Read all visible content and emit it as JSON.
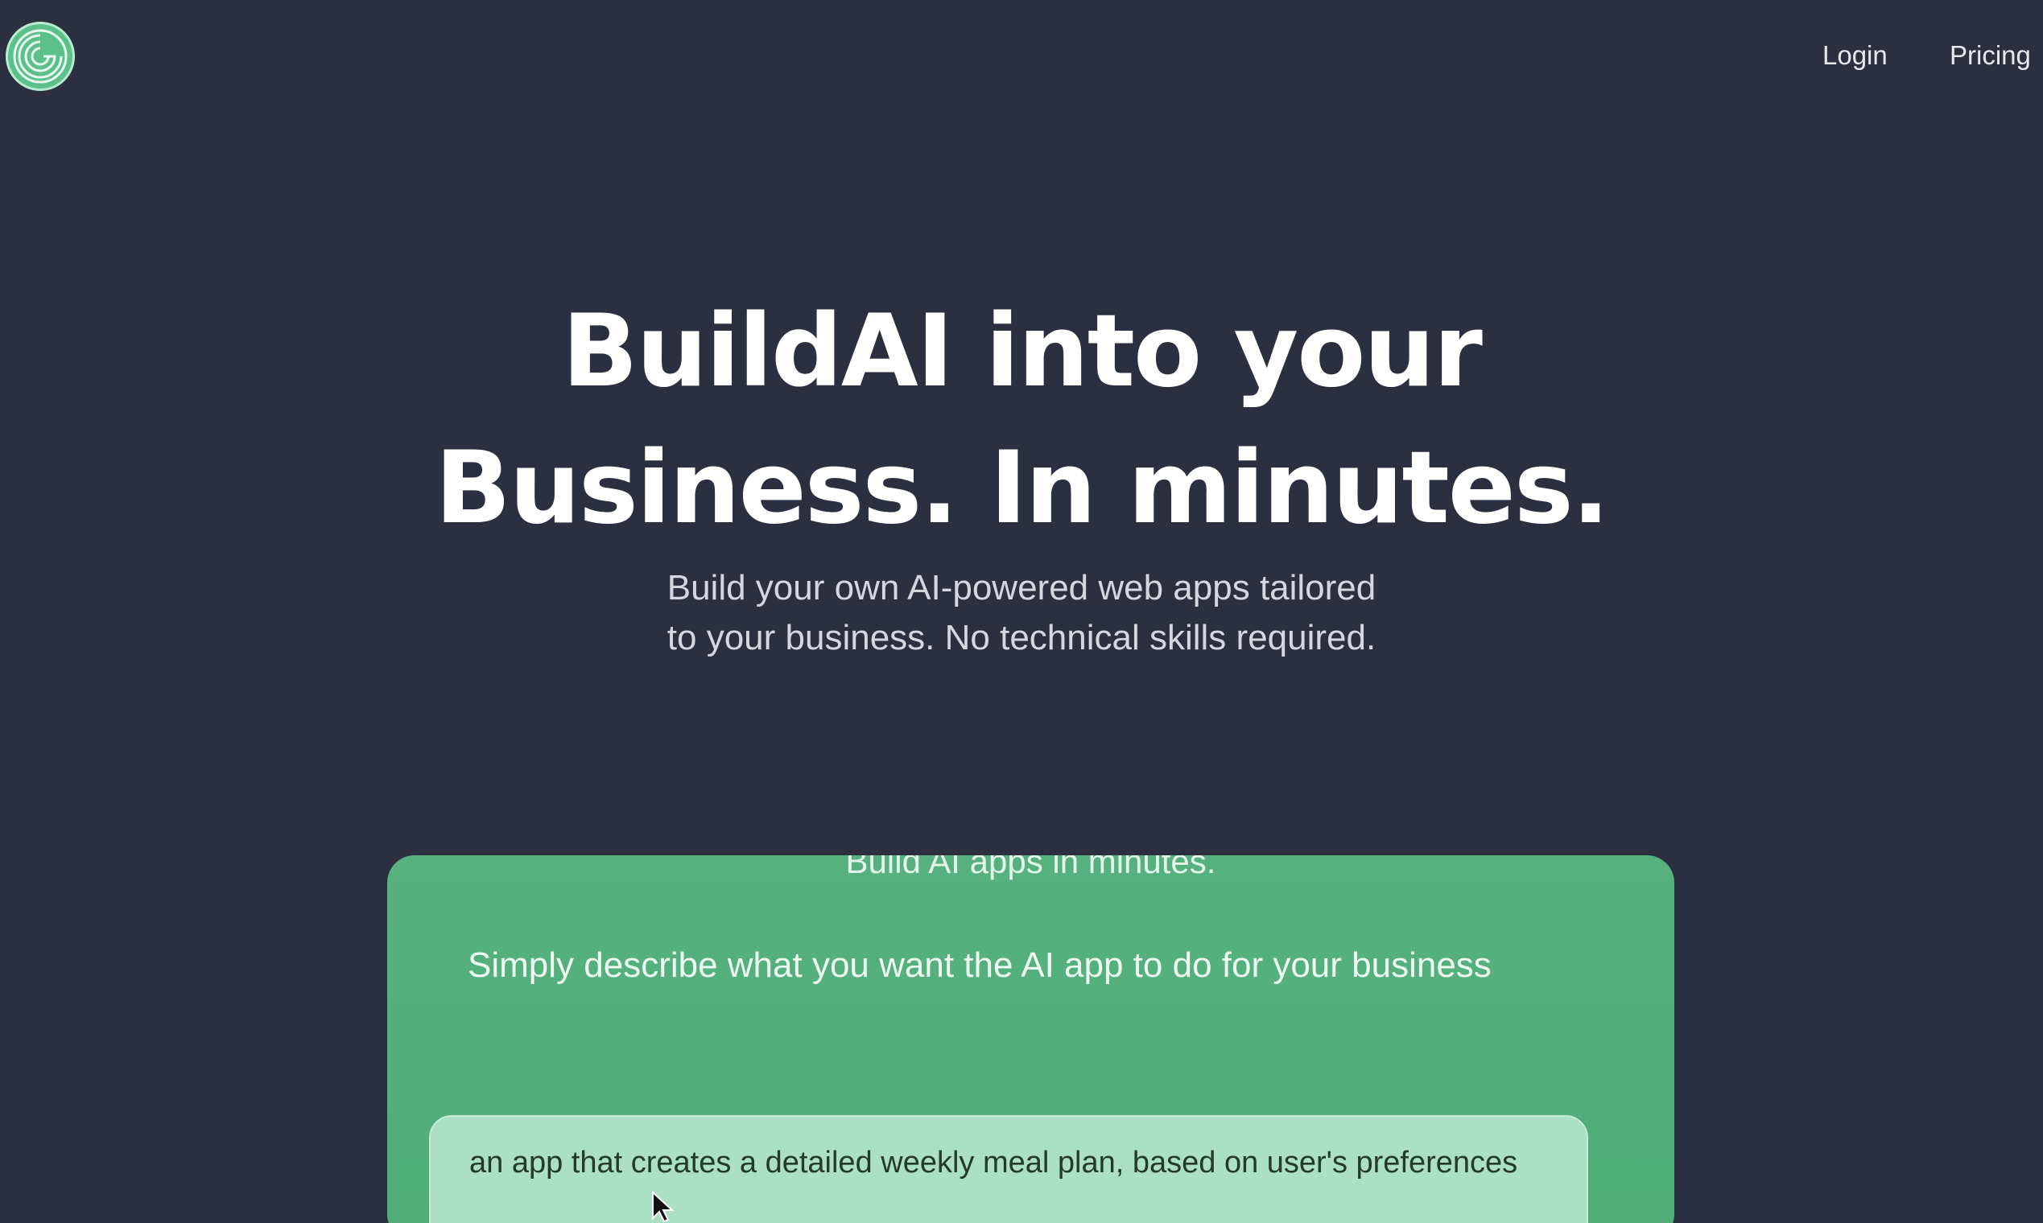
{
  "header": {
    "logo_icon": "spiral-logo-icon",
    "nav": [
      {
        "label": "Login"
      },
      {
        "label": "Pricing"
      }
    ]
  },
  "hero": {
    "headline_line1": "BuildAI into your",
    "headline_line2": "Business. In minutes.",
    "subtitle_line1": "Build your own AI-powered web apps tailored",
    "subtitle_line2": "to your business. No technical skills required."
  },
  "demo_card": {
    "title": "Build AI apps in minutes.",
    "description": "Simply describe what you want the AI app to do for your business",
    "prompt_value": "an app that creates a detailed weekly meal plan, based on user's preferences"
  },
  "colors": {
    "background": "#2b2f40",
    "accent_green": "#56b17e",
    "prompt_box": "#ace0c3"
  }
}
